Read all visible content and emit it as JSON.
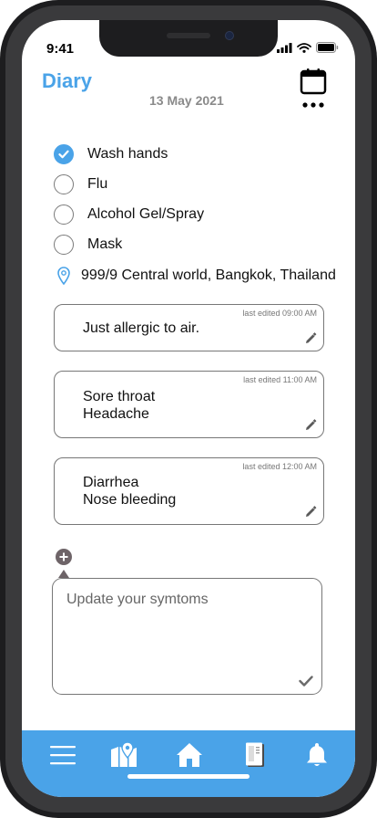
{
  "status_bar": {
    "time": "9:41"
  },
  "header": {
    "title": "Diary",
    "date": "13 May 2021",
    "calendar_icon": "calendar-icon",
    "more_icon": "more-horizontal-icon"
  },
  "checklist": [
    {
      "label": "Wash hands",
      "checked": true
    },
    {
      "label": "Flu",
      "checked": false
    },
    {
      "label": "Alcohol Gel/Spray",
      "checked": false
    },
    {
      "label": "Mask",
      "checked": false
    }
  ],
  "location": {
    "address": "999/9 Central world, Bangkok, Thailand"
  },
  "notes": [
    {
      "meta": "last edited 09:00 AM",
      "text": "Just allergic to air."
    },
    {
      "meta": "last edited 11:00 AM",
      "text": "Sore throat\nHeadache"
    },
    {
      "meta": "last edited 12:00 AM",
      "text": "Diarrhea\nNose bleeding"
    }
  ],
  "symptom_input": {
    "placeholder": "Update your symtoms"
  },
  "bottom_nav": [
    {
      "name": "menu",
      "icon": "menu-icon"
    },
    {
      "name": "map",
      "icon": "map-pin-icon"
    },
    {
      "name": "home",
      "icon": "home-icon"
    },
    {
      "name": "notebook",
      "icon": "notebook-icon"
    },
    {
      "name": "notifications",
      "icon": "bell-icon"
    }
  ],
  "colors": {
    "accent": "#4aa3e8",
    "muted_text": "#8a8a8a",
    "border": "#777777",
    "add_button": "#6e6468"
  }
}
